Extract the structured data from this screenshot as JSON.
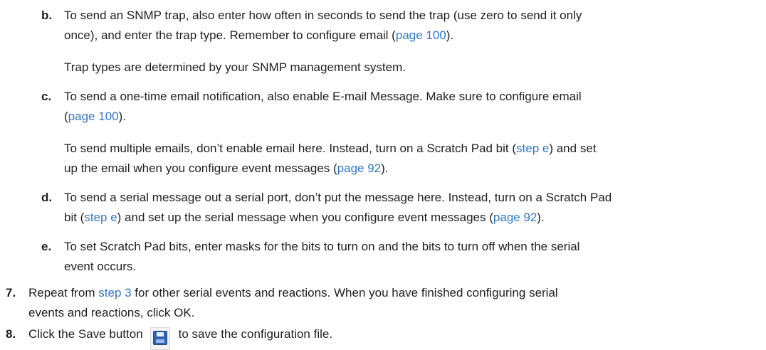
{
  "items": {
    "b": {
      "label": "b.",
      "line1": "To send an SNMP trap, also enter how often in seconds to send the trap (use zero to send it only",
      "line2_pre": "once), and enter the trap type. Remember to configure email (",
      "line2_link": "page 100",
      "line2_post": ").",
      "note": "Trap types are determined by your SNMP management system."
    },
    "c": {
      "label": "c.",
      "line1": "To send a one-time email notification, also enable E-mail Message. Make sure to configure email",
      "line2_pre": "(",
      "line2_link": "page 100",
      "line2_post": ").",
      "note1_pre": "To send multiple emails, don’t enable email here. Instead, turn on a Scratch Pad bit (",
      "note1_link": "step e",
      "note1_post": ") and set",
      "note2_pre": "up the email when you configure event messages (",
      "note2_link": "page 92",
      "note2_post": ")."
    },
    "d": {
      "label": "d.",
      "line1": "To send a serial message out a serial port, don’t put the message here. Instead, turn on a Scratch Pad",
      "line2_pre": "bit (",
      "line2_link1": "step e",
      "line2_mid": ") and set up the serial message when you configure event messages (",
      "line2_link2": "page 92",
      "line2_post": ")."
    },
    "e": {
      "label": "e.",
      "line1": "To set Scratch Pad bits, enter masks for the bits to turn on and the bits to turn off when the serial",
      "line2": "event occurs."
    },
    "step7": {
      "label": "7.",
      "line1_pre": "Repeat from ",
      "line1_link": "step 3",
      "line1_post": " for other serial events and reactions. When you have finished configuring serial",
      "line2": "events and reactions, click OK."
    },
    "step8": {
      "label": "8.",
      "pre": "Click the Save button",
      "icon": "save-icon",
      "post": "to save the configuration file."
    }
  },
  "colors": {
    "link": "#2f78c8",
    "text": "#1f1f1f"
  }
}
